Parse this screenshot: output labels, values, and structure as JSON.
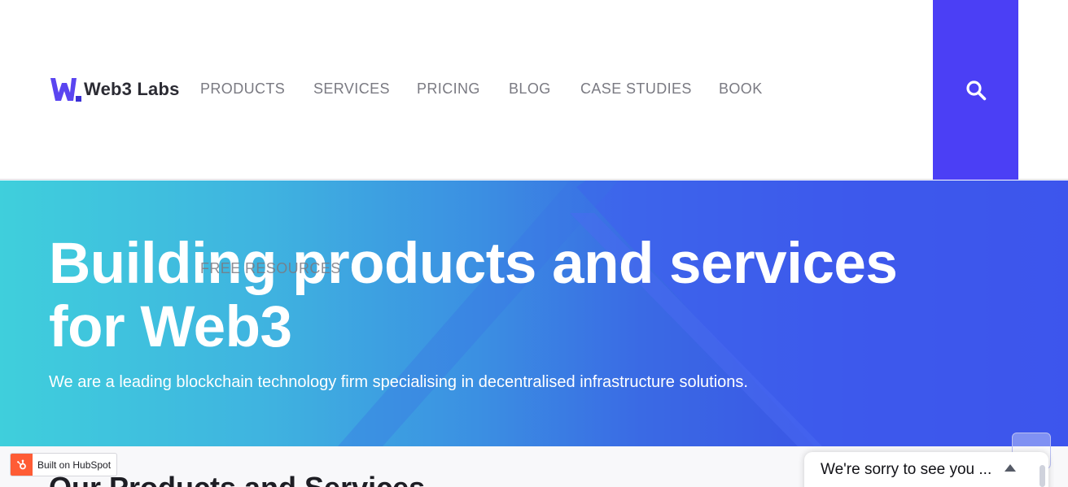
{
  "header": {
    "logo_text": "Web3 Labs",
    "nav": [
      {
        "label": "PRODUCTS"
      },
      {
        "label": "SERVICES"
      },
      {
        "label": "PRICING"
      },
      {
        "label": "BLOG"
      },
      {
        "label": "CASE STUDIES"
      },
      {
        "label": "BOOK"
      }
    ],
    "overflow_nav_label": "FREE RESOURCES",
    "search_icon": "search-icon"
  },
  "hero": {
    "title": "Building products and services for Web3",
    "subtitle": "We are a leading blockchain technology firm specialising in decentralised infrastructure solutions."
  },
  "section": {
    "title": "Our Products and Services"
  },
  "hubspot_badge": {
    "label": "Built on HubSpot",
    "icon": "hubspot-sprocket-icon"
  },
  "chat_widget": {
    "message": "We're sorry to see you ...",
    "icon": "chevron-up-icon"
  },
  "colors": {
    "accent": "#4b3ff5",
    "hero_gradient_start": "#3fcfdc",
    "hero_gradient_end": "#3a4be8",
    "nav_text": "#7a7a82",
    "hubspot_orange": "#ff5c35"
  }
}
